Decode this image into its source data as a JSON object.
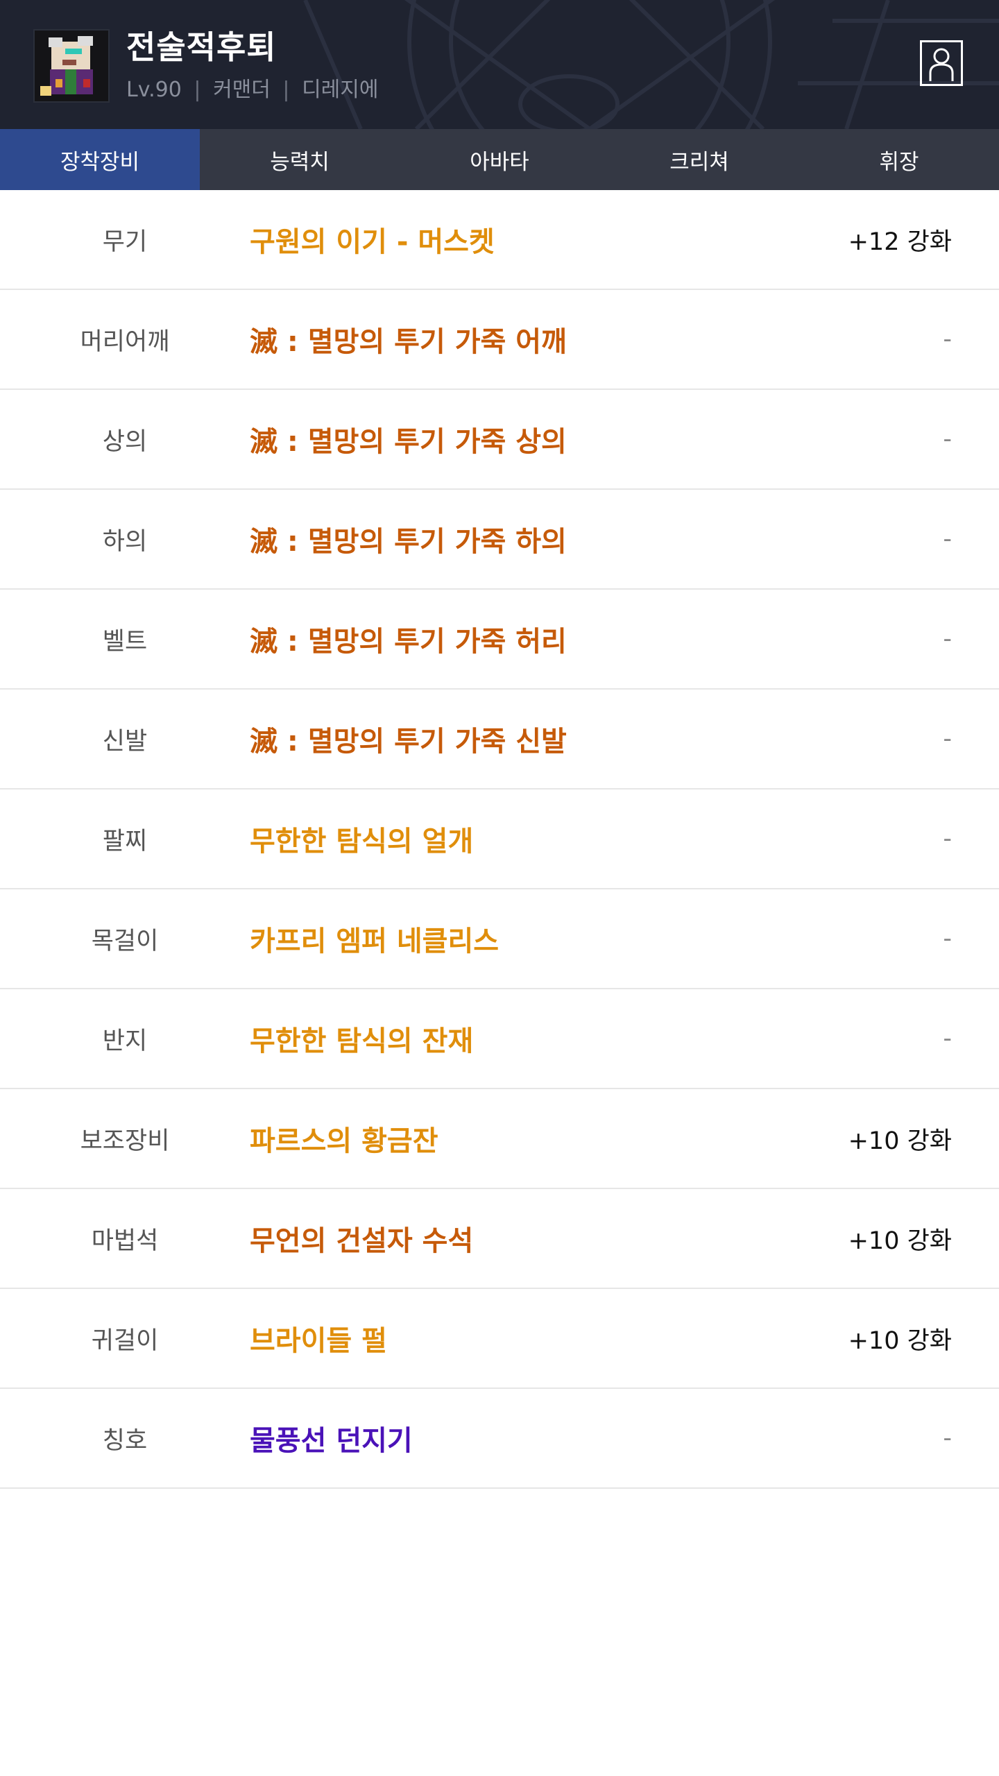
{
  "header": {
    "character_name": "전술적후퇴",
    "level": "Lv.90",
    "job": "커맨더",
    "server": "디레지에",
    "separator": "|"
  },
  "tabs": [
    {
      "label": "장착장비",
      "active": true
    },
    {
      "label": "능력치",
      "active": false
    },
    {
      "label": "아바타",
      "active": false
    },
    {
      "label": "크리쳐",
      "active": false
    },
    {
      "label": "휘장",
      "active": false
    }
  ],
  "rarity_colors": {
    "unique": "#e08e0b",
    "epic": "#c65a09",
    "legendary": "#d97706",
    "rare": "#4a12b8"
  },
  "equipment": [
    {
      "slot": "무기",
      "name": "구원의 이기 - 머스켓",
      "enhance": "+12 강화",
      "color": "#e08e0b"
    },
    {
      "slot": "머리어깨",
      "name": "滅 : 멸망의 투기 가죽 어깨",
      "enhance": "-",
      "color": "#c65a09"
    },
    {
      "slot": "상의",
      "name": "滅 : 멸망의 투기 가죽 상의",
      "enhance": "-",
      "color": "#c65a09"
    },
    {
      "slot": "하의",
      "name": "滅 : 멸망의 투기 가죽 하의",
      "enhance": "-",
      "color": "#c65a09"
    },
    {
      "slot": "벨트",
      "name": "滅 : 멸망의 투기 가죽 허리",
      "enhance": "-",
      "color": "#c65a09"
    },
    {
      "slot": "신발",
      "name": "滅 : 멸망의 투기 가죽 신발",
      "enhance": "-",
      "color": "#c65a09"
    },
    {
      "slot": "팔찌",
      "name": "무한한 탐식의 얼개",
      "enhance": "-",
      "color": "#e08e0b"
    },
    {
      "slot": "목걸이",
      "name": "카프리 엠퍼 네클리스",
      "enhance": "-",
      "color": "#e08e0b"
    },
    {
      "slot": "반지",
      "name": "무한한 탐식의 잔재",
      "enhance": "-",
      "color": "#e08e0b"
    },
    {
      "slot": "보조장비",
      "name": "파르스의 황금잔",
      "enhance": "+10 강화",
      "color": "#e08e0b"
    },
    {
      "slot": "마법석",
      "name": "무언의 건설자 수석",
      "enhance": "+10 강화",
      "color": "#c65a09"
    },
    {
      "slot": "귀걸이",
      "name": "브라이들 펄",
      "enhance": "+10 강화",
      "color": "#e08e0b"
    },
    {
      "slot": "칭호",
      "name": "물풍선 던지기",
      "enhance": "-",
      "color": "#4a12b8"
    }
  ],
  "icons": {
    "avatar": "character-portrait-icon",
    "profile": "profile-icon"
  }
}
